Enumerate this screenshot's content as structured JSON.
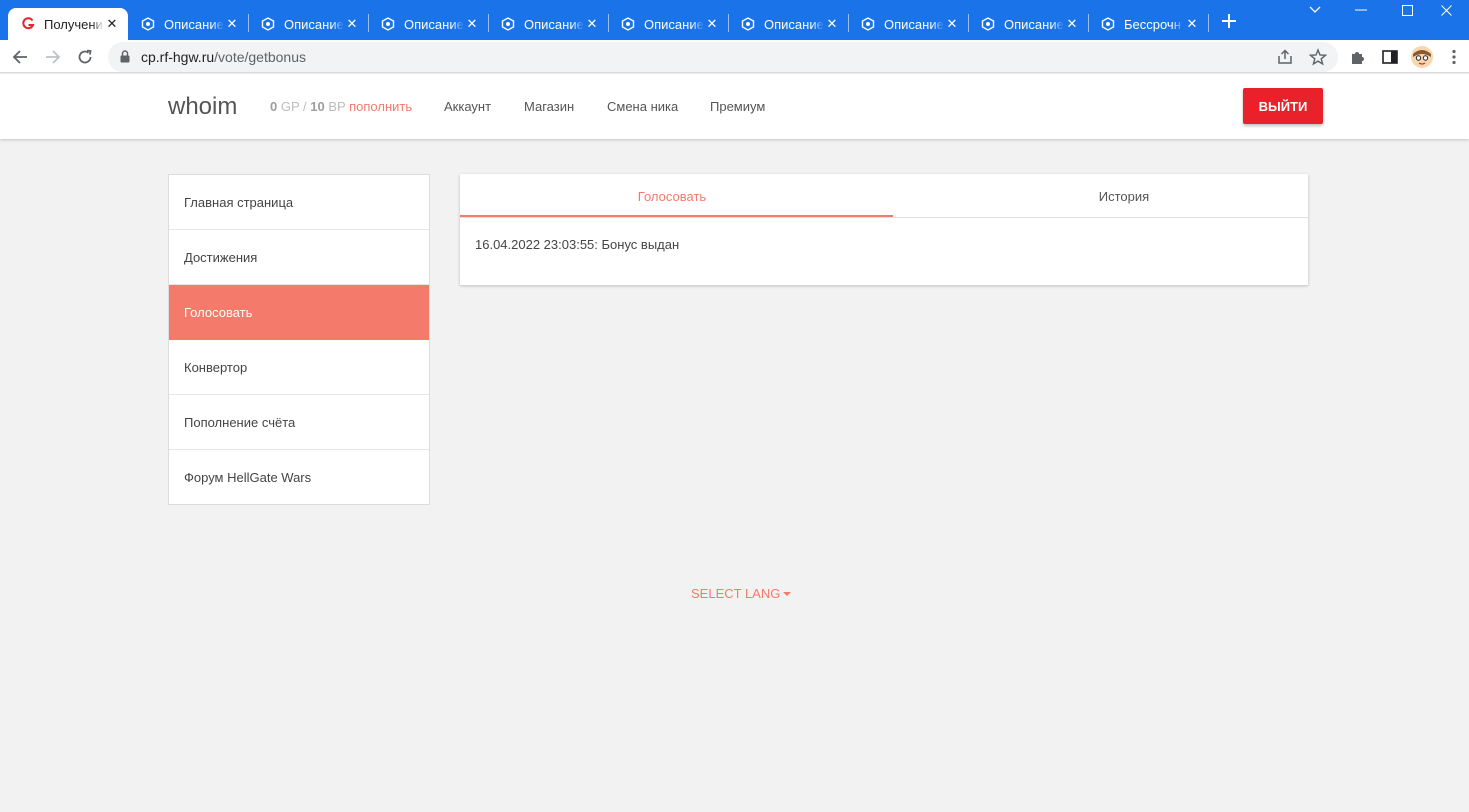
{
  "browser": {
    "tabs": [
      {
        "title": "Получени",
        "active": true
      },
      {
        "title": "Описание",
        "active": false
      },
      {
        "title": "Описание",
        "active": false
      },
      {
        "title": "Описание",
        "active": false
      },
      {
        "title": "Описание",
        "active": false
      },
      {
        "title": "Описание",
        "active": false
      },
      {
        "title": "Описание",
        "active": false
      },
      {
        "title": "Описание",
        "active": false
      },
      {
        "title": "Описание",
        "active": false
      },
      {
        "title": "Бессрочн",
        "active": false
      }
    ],
    "url_host": "cp.rf-hgw.ru",
    "url_path": "/vote/getbonus",
    "chrome_color": "#1a73e8"
  },
  "header": {
    "username": "whoim",
    "gp_value": "0",
    "gp_unit": "GP",
    "balance_sep": "/",
    "bp_value": "10",
    "bp_unit": "BP",
    "topup_label": "пополнить",
    "nav": [
      "Аккаунт",
      "Магазин",
      "Смена ника",
      "Премиум"
    ],
    "logout_label": "ВЫЙТИ"
  },
  "sidebar": {
    "items": [
      {
        "label": "Главная страница",
        "active": false
      },
      {
        "label": "Достижения",
        "active": false
      },
      {
        "label": "Голосовать",
        "active": true
      },
      {
        "label": "Конвертор",
        "active": false
      },
      {
        "label": "Пополнение счёта",
        "active": false
      },
      {
        "label": "Форум HellGate Wars",
        "active": false
      }
    ]
  },
  "main": {
    "tabs": [
      {
        "label": "Голосовать",
        "active": true
      },
      {
        "label": "История",
        "active": false
      }
    ],
    "history_entry": "16.04.2022 23:03:55: Бонус выдан"
  },
  "footer": {
    "select_lang": "SELECT LANG"
  },
  "colors": {
    "accent": "#f47a6b",
    "logout": "#e8212a",
    "background": "#f2f2f2"
  }
}
